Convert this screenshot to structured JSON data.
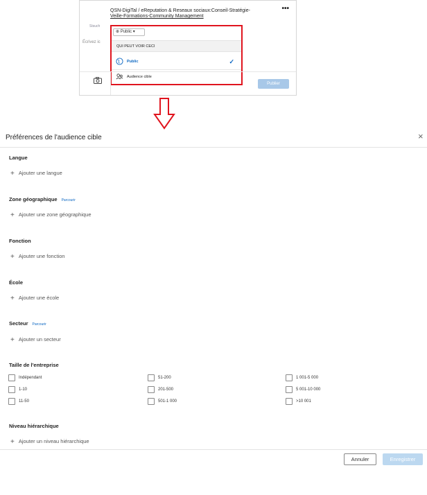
{
  "composer": {
    "logo_text": "Stsuch",
    "company_line1": "QSN-DigiTal / eReputation & Reseaux sociaux:Conseil-Stratégie-",
    "company_line2": "Veille-Formations-Community Management",
    "more": "•••",
    "placeholder": "Écrivez ic",
    "visibility_button": "Public",
    "publish_button": "Publier"
  },
  "visibility_menu": {
    "header": "QUI PEUT VOIR CECI",
    "items": [
      {
        "label": "Public",
        "icon": "globe-icon",
        "selected": true
      },
      {
        "label": "Audience cible",
        "icon": "people-icon",
        "selected": false
      }
    ],
    "check": "✓"
  },
  "modal": {
    "title": "Préférences de l'audience cible",
    "close": "×",
    "sections": {
      "langue": {
        "title": "Langue",
        "add": "Ajouter une langue"
      },
      "zone": {
        "title": "Zone géographique",
        "browse": "Parcourir",
        "add": "Ajouter une zone géographique"
      },
      "fonction": {
        "title": "Fonction",
        "add": "Ajouter une fonction"
      },
      "ecole": {
        "title": "École",
        "add": "Ajouter une école"
      },
      "secteur": {
        "title": "Secteur",
        "browse": "Parcourir",
        "add": "Ajouter un secteur"
      },
      "taille": {
        "title": "Taille de l'entreprise",
        "options": [
          "Indépendant",
          "51-200",
          "1 001-5 000",
          "1-10",
          "201-500",
          "5 001-10 000",
          "11-50",
          "501-1 000",
          ">10 001"
        ]
      },
      "niveau": {
        "title": "Niveau hiérarchique",
        "add": "Ajouter un niveau hiérarchique"
      }
    },
    "cancel_button": "Annuler",
    "save_button": "Enregistrer"
  },
  "colors": {
    "accent": "#0a66c2",
    "highlight_border": "#e0141e",
    "arrow": "#e0141e"
  }
}
